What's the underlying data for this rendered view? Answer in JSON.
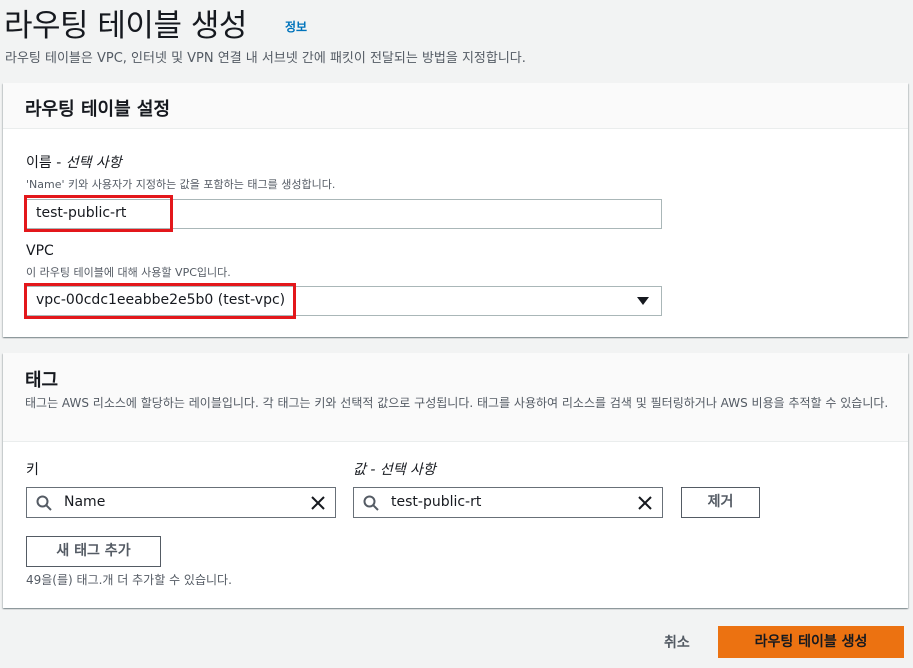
{
  "page": {
    "title": "라우팅 테이블 생성",
    "info_link": "정보",
    "description": "라우팅 테이블은 VPC, 인터넷 및 VPN 연결 내 서브넷 간에 패킷이 전달되는 방법을 지정합니다."
  },
  "settings": {
    "title": "라우팅 테이블 설정",
    "name_label": "이름 -",
    "name_optional": "선택 사항",
    "name_desc": "'Name' 키와 사용자가 지정하는 값을 포함하는 태그를 생성합니다.",
    "name_value": "test-public-rt",
    "vpc_label": "VPC",
    "vpc_desc": "이 라우팅 테이블에 대해 사용할 VPC입니다.",
    "vpc_value": "vpc-00cdc1eeabbe2e5b0 (test-vpc)"
  },
  "tags": {
    "title": "태그",
    "description": "태그는 AWS 리소스에 할당하는 레이블입니다. 각 태그는 키와 선택적 값으로 구성됩니다. 태그를 사용하여 리소스를 검색 및 필터링하거나 AWS 비용을 추적할 수 있습니다.",
    "key_label": "키",
    "value_label": "값 -",
    "value_optional": "선택 사항",
    "rows": [
      {
        "key": "Name",
        "value": "test-public-rt",
        "remove_label": "제거"
      }
    ],
    "add_button": "새 태그 추가",
    "limit_note": "49을(를) 태그.개 더 추가할 수 있습니다."
  },
  "footer": {
    "cancel": "취소",
    "submit": "라우팅 테이블 생성"
  },
  "colors": {
    "highlight": "#e3171b",
    "primary": "#ec7211",
    "link": "#0073bb"
  }
}
